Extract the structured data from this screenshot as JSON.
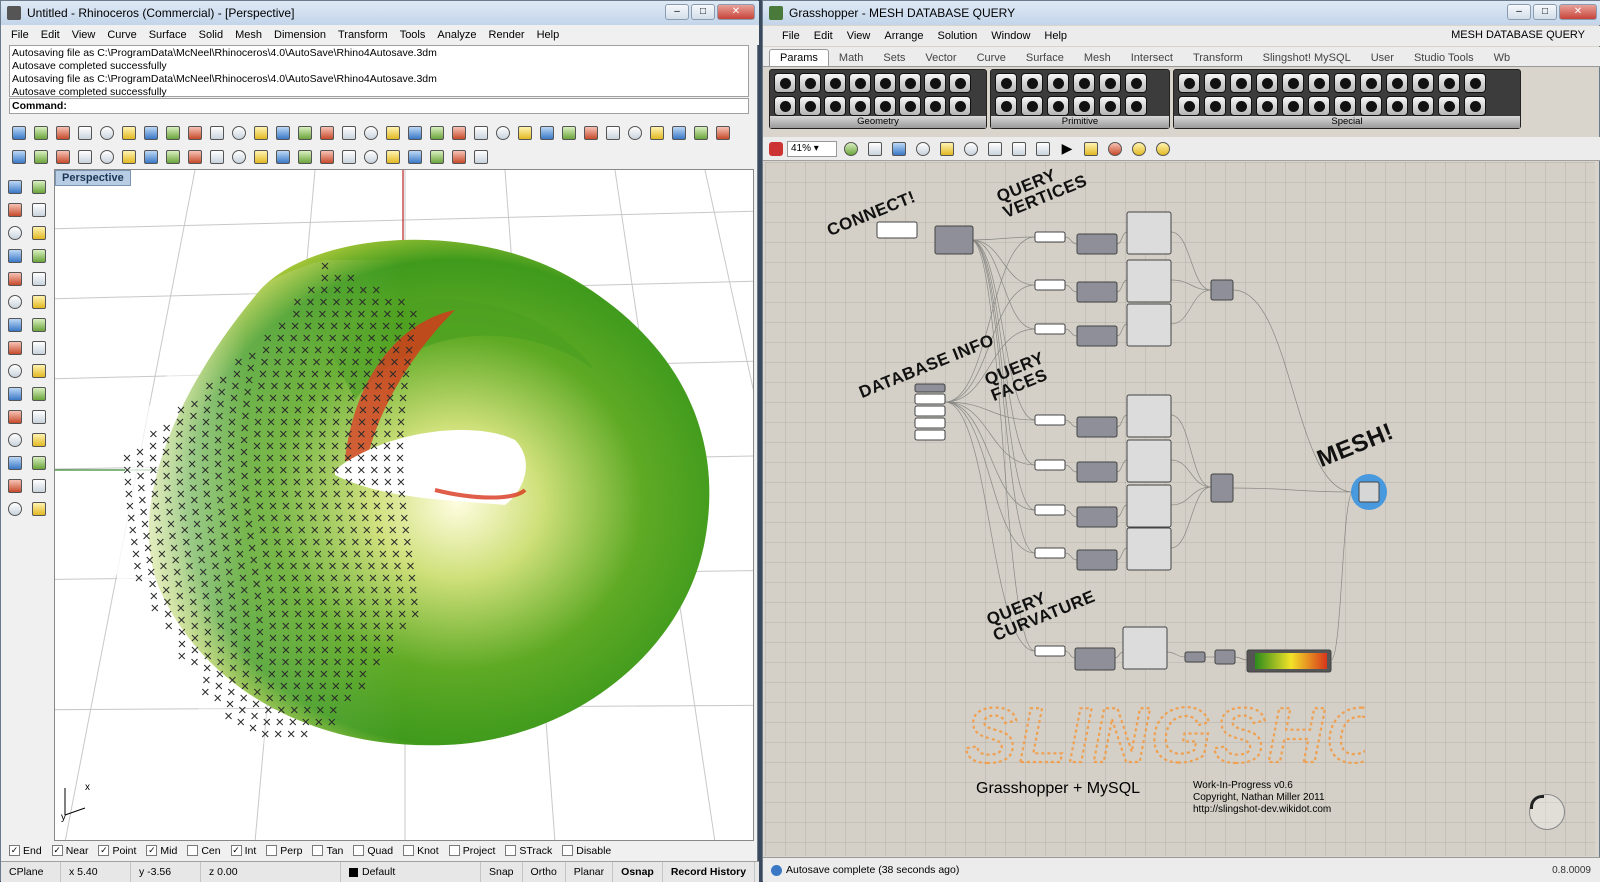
{
  "rhino": {
    "title": "Untitled - Rhinoceros (Commercial) - [Perspective]",
    "menu": [
      "File",
      "Edit",
      "View",
      "Curve",
      "Surface",
      "Solid",
      "Mesh",
      "Dimension",
      "Transform",
      "Tools",
      "Analyze",
      "Render",
      "Help"
    ],
    "history": [
      "Autosaving file as C:\\ProgramData\\McNeel\\Rhinoceros\\4.0\\AutoSave\\Rhino4Autosave.3dm",
      "Autosave completed successfully",
      "Autosaving file as C:\\ProgramData\\McNeel\\Rhinoceros\\4.0\\AutoSave\\Rhino4Autosave.3dm",
      "Autosave completed successfully"
    ],
    "command_label": "Command:",
    "viewport_label": "Perspective",
    "axis_x": "x",
    "axis_y": "y",
    "osnaps": [
      {
        "label": "End",
        "checked": true
      },
      {
        "label": "Near",
        "checked": true
      },
      {
        "label": "Point",
        "checked": true
      },
      {
        "label": "Mid",
        "checked": true
      },
      {
        "label": "Cen",
        "checked": false
      },
      {
        "label": "Int",
        "checked": true
      },
      {
        "label": "Perp",
        "checked": false
      },
      {
        "label": "Tan",
        "checked": false
      },
      {
        "label": "Quad",
        "checked": false
      },
      {
        "label": "Knot",
        "checked": false
      },
      {
        "label": "Project",
        "checked": false
      },
      {
        "label": "STrack",
        "checked": false
      },
      {
        "label": "Disable",
        "checked": false
      }
    ],
    "status": {
      "cplane": "CPlane",
      "x": "x 5.40",
      "y": "y -3.56",
      "z": "z 0.00",
      "layer": "Default",
      "snap": "Snap",
      "ortho": "Ortho",
      "planar": "Planar",
      "osnap": "Osnap",
      "record": "Record History"
    },
    "colors": {
      "mesh_green": "#3f9a1c",
      "mesh_yellow": "#e8e24a",
      "mesh_red": "#d8361b",
      "point_marker": "#2b2b2b"
    }
  },
  "gh": {
    "title": "Grasshopper - MESH DATABASE QUERY",
    "menu": [
      "File",
      "Edit",
      "View",
      "Arrange",
      "Solution",
      "Window",
      "Help"
    ],
    "doc_name": "MESH DATABASE QUERY",
    "tabs": [
      "Params",
      "Math",
      "Sets",
      "Vector",
      "Curve",
      "Surface",
      "Mesh",
      "Intersect",
      "Transform",
      "Slingshot! MySQL",
      "User",
      "Studio Tools",
      "Wb"
    ],
    "active_tab": "Params",
    "palettes": [
      "Geometry",
      "Primitive",
      "Special"
    ],
    "zoom": "41%",
    "annotations": {
      "connect": "CONNECT!",
      "query_vertices": "QUERY\nVERTICES",
      "database_info": "DATABASE INFO",
      "query_faces": "QUERY\nFACES",
      "query_curvature": "QUERY\nCURVATURE",
      "mesh": "MESH!",
      "slingshot": "SLINGSHOT!"
    },
    "subtitle": "Grasshopper + MySQL",
    "credits": [
      "Work-In-Progress v0.6",
      "Copyright, Nathan Miller 2011",
      "http://slingshot-dev.wikidot.com"
    ],
    "status": "Autosave complete (38 seconds ago)",
    "version": "0.8.0009",
    "colors": {
      "canvas": "#d4d0c7",
      "component": "#8e8f99",
      "selected": "#2f8fe0",
      "slingshot": "#f0a050"
    }
  }
}
